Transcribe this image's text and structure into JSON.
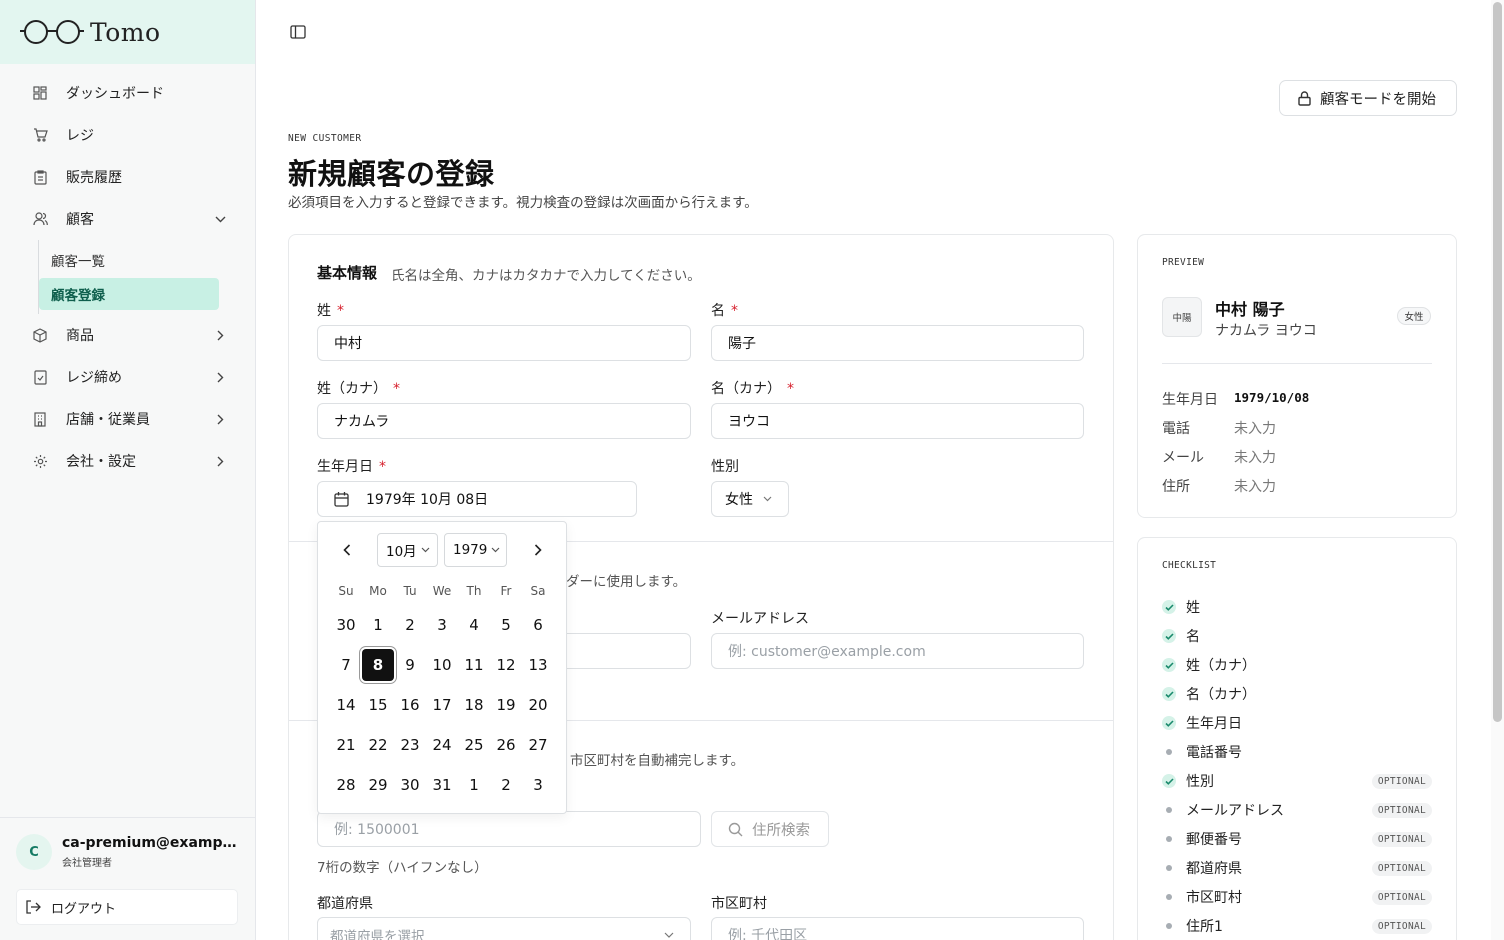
{
  "app": {
    "logo_text": "Tomo"
  },
  "sidebar": {
    "items": [
      {
        "label": "ダッシュボード",
        "icon": "dashboard-icon"
      },
      {
        "label": "レジ",
        "icon": "cart-icon"
      },
      {
        "label": "販売履歴",
        "icon": "clipboard-icon"
      },
      {
        "label": "顧客",
        "icon": "users-icon",
        "expanded": true
      },
      {
        "label": "商品",
        "icon": "package-icon"
      },
      {
        "label": "レジ締め",
        "icon": "register-close-icon"
      },
      {
        "label": "店舗・従業員",
        "icon": "building-icon"
      },
      {
        "label": "会社・設定",
        "icon": "gear-icon"
      }
    ],
    "customer_sub": [
      {
        "label": "顧客一覧",
        "active": false
      },
      {
        "label": "顧客登録",
        "active": true
      }
    ],
    "user": {
      "initial": "C",
      "email": "ca-premium@example.com",
      "role": "会社管理者"
    },
    "logout_label": "ログアウト"
  },
  "header": {
    "customer_mode_label": "顧客モードを開始"
  },
  "page": {
    "eyebrow": "NEW CUSTOMER",
    "title": "新規顧客の登録",
    "subtitle": "必須項目を入力すると登録できます。視力検査の登録は次画面から行えます。"
  },
  "form": {
    "basic": {
      "title": "基本情報",
      "hint": "氏名は全角、カナはカタカナで入力してください。",
      "last_name_label": "姓",
      "last_name_value": "中村",
      "first_name_label": "名",
      "first_name_value": "陽子",
      "last_kana_label": "姓（カナ）",
      "last_kana_value": "ナカムラ",
      "first_kana_label": "名（カナ）",
      "first_kana_value": "ヨウコ",
      "birth_label": "生年月日",
      "birth_value": "1979年 10月 08日",
      "gender_label": "性別",
      "gender_value": "女性",
      "required_mark": "*"
    },
    "contact": {
      "hint_partial": "ダーに使用します。",
      "email_label": "メールアドレス",
      "email_placeholder": "例: customer@example.com"
    },
    "address": {
      "hint_partial": "市区町村を自動補完します。",
      "zip_placeholder": "例: 1500001",
      "zip_search_label": "住所検索",
      "zip_help": "7桁の数字（ハイフンなし）",
      "pref_label": "都道府県",
      "pref_placeholder": "都道府県を選択",
      "city_label": "市区町村",
      "city_placeholder": "例: 千代田区"
    }
  },
  "calendar": {
    "month_value": "10月",
    "year_value": "1979",
    "weekdays": [
      "Su",
      "Mo",
      "Tu",
      "We",
      "Th",
      "Fr",
      "Sa"
    ],
    "weeks": [
      [
        "30",
        "1",
        "2",
        "3",
        "4",
        "5",
        "6"
      ],
      [
        "7",
        "8",
        "9",
        "10",
        "11",
        "12",
        "13"
      ],
      [
        "14",
        "15",
        "16",
        "17",
        "18",
        "19",
        "20"
      ],
      [
        "21",
        "22",
        "23",
        "24",
        "25",
        "26",
        "27"
      ],
      [
        "28",
        "29",
        "30",
        "31",
        "1",
        "2",
        "3"
      ]
    ],
    "selected_day": "8"
  },
  "preview": {
    "title": "PREVIEW",
    "avatar_text": "中陽",
    "name": "中村 陽子",
    "kana": "ナカムラ ヨウコ",
    "badge": "女性",
    "rows": [
      {
        "key": "生年月日",
        "value": "1979/10/08"
      },
      {
        "key": "電話",
        "value": "未入力"
      },
      {
        "key": "メール",
        "value": "未入力"
      },
      {
        "key": "住所",
        "value": "未入力"
      }
    ]
  },
  "checklist": {
    "title": "CHECKLIST",
    "items": [
      {
        "label": "姓",
        "done": true,
        "tag": ""
      },
      {
        "label": "名",
        "done": true,
        "tag": ""
      },
      {
        "label": "姓（カナ）",
        "done": true,
        "tag": ""
      },
      {
        "label": "名（カナ）",
        "done": true,
        "tag": ""
      },
      {
        "label": "生年月日",
        "done": true,
        "tag": ""
      },
      {
        "label": "電話番号",
        "done": false,
        "tag": ""
      },
      {
        "label": "性別",
        "done": true,
        "tag": "OPTIONAL"
      },
      {
        "label": "メールアドレス",
        "done": false,
        "tag": "OPTIONAL"
      },
      {
        "label": "郵便番号",
        "done": false,
        "tag": "OPTIONAL"
      },
      {
        "label": "都道府県",
        "done": false,
        "tag": "OPTIONAL"
      },
      {
        "label": "市区町村",
        "done": false,
        "tag": "OPTIONAL"
      },
      {
        "label": "住所1",
        "done": false,
        "tag": "OPTIONAL"
      }
    ]
  },
  "colors": {
    "accent": "#c8f0e4",
    "logo_bg": "#e3f6f0",
    "required": "#d61f2c"
  }
}
